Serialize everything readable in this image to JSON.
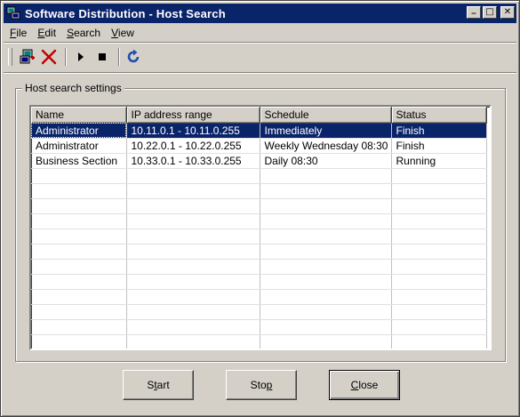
{
  "window": {
    "title": "Software Distribution - Host Search",
    "controls": {
      "minimize": "_",
      "maximize": "□",
      "close": "✕"
    }
  },
  "menu": [
    {
      "label_u": "F",
      "label_rest": "ile"
    },
    {
      "label_u": "E",
      "label_rest": "dit"
    },
    {
      "label_u": "S",
      "label_rest": "earch"
    },
    {
      "label_u": "V",
      "label_rest": "iew"
    }
  ],
  "toolbar": {
    "icons": [
      "new-search-icon",
      "delete-icon",
      "play-icon",
      "stop-icon",
      "refresh-icon"
    ]
  },
  "group": {
    "label": "Host search settings"
  },
  "table": {
    "columns": [
      "Name",
      "IP address range",
      "Schedule",
      "Status"
    ],
    "rows": [
      {
        "name": "Administrator",
        "ip": "10.11.0.1 - 10.11.0.255",
        "schedule": "Immediately",
        "status": "Finish",
        "selected": true
      },
      {
        "name": "Administrator",
        "ip": "10.22.0.1 - 10.22.0.255",
        "schedule": "Weekly Wednesday 08:30",
        "status": "Finish"
      },
      {
        "name": "Business Section",
        "ip": "10.33.0.1 - 10.33.0.255",
        "schedule": "Daily 08:30",
        "status": "Running"
      }
    ]
  },
  "buttons": {
    "start": {
      "u": "",
      "pre": "S",
      "label_u": "t",
      "post": "art"
    },
    "stop": {
      "pre": "Sto",
      "label_u": "p",
      "post": ""
    },
    "close": {
      "pre": "",
      "label_u": "C",
      "post": "lose"
    }
  },
  "colors": {
    "face": "#d4d0c8",
    "title": "#0a246a",
    "selection": "#0a246a"
  }
}
